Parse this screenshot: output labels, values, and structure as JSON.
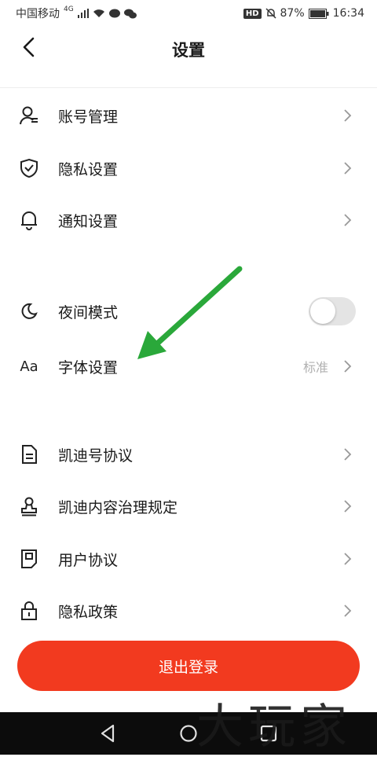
{
  "status_bar": {
    "carrier": "中国移动",
    "network": "4G",
    "hd_badge": "HD",
    "battery": "87%",
    "time": "16:34"
  },
  "header": {
    "title": "设置",
    "back_icon": "chevron-left-icon"
  },
  "sections": [
    {
      "items": [
        {
          "label": "账号管理",
          "icon": "user-icon"
        },
        {
          "label": "隐私设置",
          "icon": "shield-icon"
        },
        {
          "label": "通知设置",
          "icon": "bell-icon"
        }
      ]
    },
    {
      "items": [
        {
          "label": "夜间模式",
          "icon": "moon-icon",
          "toggle_on": false
        },
        {
          "label": "字体设置",
          "icon": "font-icon",
          "icon_text": "Aa",
          "value": "标准"
        }
      ]
    },
    {
      "items": [
        {
          "label": "凯迪号协议",
          "icon": "document-icon"
        },
        {
          "label": "凯迪内容治理规定",
          "icon": "stamp-icon"
        },
        {
          "label": "用户协议",
          "icon": "note-icon"
        },
        {
          "label": "隐私政策",
          "icon": "lock-icon"
        }
      ]
    }
  ],
  "logout_label": "退出登录",
  "watermark": "大玩家",
  "colors": {
    "accent": "#f23a1f",
    "arrow": "#2aa83a",
    "nav_bar": "#0c0c0c",
    "toggle_off": "#e4e4e4"
  }
}
